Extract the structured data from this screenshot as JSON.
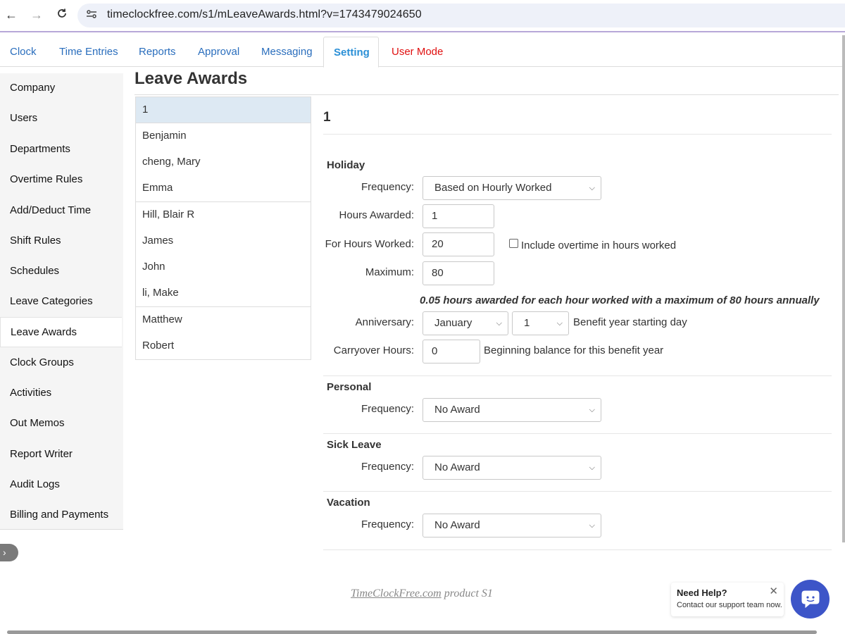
{
  "browser": {
    "url": "timeclockfree.com/s1/mLeaveAwards.html?v=1743479024650"
  },
  "tabs": [
    {
      "label": "Clock"
    },
    {
      "label": "Time Entries"
    },
    {
      "label": "Reports"
    },
    {
      "label": "Approval"
    },
    {
      "label": "Messaging"
    },
    {
      "label": "Setting"
    },
    {
      "label": "User Mode"
    }
  ],
  "sidebar": {
    "items": [
      {
        "label": "Company"
      },
      {
        "label": "Users"
      },
      {
        "label": "Departments"
      },
      {
        "label": "Overtime Rules"
      },
      {
        "label": "Add/Deduct Time"
      },
      {
        "label": "Shift Rules"
      },
      {
        "label": "Schedules"
      },
      {
        "label": "Leave Categories"
      },
      {
        "label": "Leave Awards"
      },
      {
        "label": "Clock Groups"
      },
      {
        "label": "Activities"
      },
      {
        "label": "Out Memos"
      },
      {
        "label": "Report Writer"
      },
      {
        "label": "Audit Logs"
      },
      {
        "label": "Billing and Payments"
      }
    ],
    "active": "Leave Awards",
    "collapse_glyph": "›"
  },
  "page": {
    "title": "Leave Awards"
  },
  "employees": [
    {
      "name": "1"
    },
    {
      "name": "Benjamin"
    },
    {
      "name": "cheng, Mary"
    },
    {
      "name": "Emma"
    },
    {
      "name": "Hill, Blair R"
    },
    {
      "name": "James"
    },
    {
      "name": "John"
    },
    {
      "name": "li, Make"
    },
    {
      "name": "Matthew"
    },
    {
      "name": "Robert"
    }
  ],
  "detail": {
    "title": "1",
    "holiday": {
      "heading": "Holiday",
      "frequency_label": "Frequency:",
      "frequency_value": "Based on Hourly Worked",
      "hours_awarded_label": "Hours Awarded:",
      "hours_awarded_value": "1",
      "for_hours_label": "For Hours Worked:",
      "for_hours_value": "20",
      "include_overtime_label": "Include overtime in hours worked",
      "maximum_label": "Maximum:",
      "maximum_value": "80",
      "summary": "0.05 hours awarded for each hour worked with a maximum of 80 hours annually",
      "anniversary_label": "Anniversary:",
      "anniversary_month": "January",
      "anniversary_day": "1",
      "anniversary_note": "Benefit year starting day",
      "carryover_label": "Carryover Hours:",
      "carryover_value": "0",
      "carryover_note": "Beginning balance for this benefit year"
    },
    "personal": {
      "heading": "Personal",
      "frequency_label": "Frequency:",
      "frequency_value": "No Award"
    },
    "sick": {
      "heading": "Sick Leave",
      "frequency_label": "Frequency:",
      "frequency_value": "No Award"
    },
    "vacation": {
      "heading": "Vacation",
      "frequency_label": "Frequency:",
      "frequency_value": "No Award"
    }
  },
  "footer": {
    "link_text": "TimeClockFree.com",
    "suffix": " product S1"
  },
  "help": {
    "title": "Need Help?",
    "subtitle": "Contact our support team now.",
    "close_glyph": "✕"
  },
  "colors": {
    "tab_link": "#2a6ebd",
    "active_tab": "#2a8fd6",
    "user_mode": "#e01010",
    "chat_button": "#3d55c8",
    "selected_row": "#dde9f3"
  }
}
